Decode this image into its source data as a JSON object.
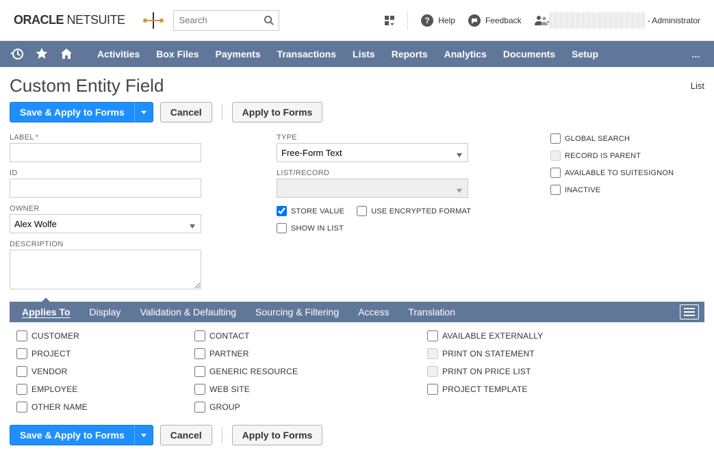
{
  "topbar": {
    "logo_oracle": "ORACLE",
    "logo_netsuite": "NETSUITE",
    "search_placeholder": "Search",
    "help_label": "Help",
    "feedback_label": "Feedback",
    "role_suffix": "- Administrator"
  },
  "nav": {
    "items": [
      "Activities",
      "Box Files",
      "Payments",
      "Transactions",
      "Lists",
      "Reports",
      "Analytics",
      "Documents",
      "Setup"
    ]
  },
  "page": {
    "title": "Custom Entity Field",
    "list_link": "List"
  },
  "buttons": {
    "save_apply": "Save & Apply to Forms",
    "cancel": "Cancel",
    "apply_forms": "Apply to Forms"
  },
  "form": {
    "label": {
      "label": "LABEL",
      "value": ""
    },
    "id": {
      "label": "ID",
      "value": ""
    },
    "owner": {
      "label": "OWNER",
      "value": "Alex Wolfe"
    },
    "description": {
      "label": "DESCRIPTION",
      "value": ""
    },
    "type": {
      "label": "TYPE",
      "value": "Free-Form Text"
    },
    "list_record": {
      "label": "LIST/RECORD",
      "value": ""
    },
    "store_value": {
      "label": "STORE VALUE",
      "checked": true
    },
    "use_encrypted": {
      "label": "USE ENCRYPTED FORMAT",
      "checked": false
    },
    "show_in_list": {
      "label": "SHOW IN LIST",
      "checked": false
    },
    "global_search": {
      "label": "GLOBAL SEARCH",
      "checked": false
    },
    "record_is_parent": {
      "label": "RECORD IS PARENT",
      "checked": false
    },
    "available_suitesignon": {
      "label": "AVAILABLE TO SUITESIGNON",
      "checked": false
    },
    "inactive": {
      "label": "INACTIVE",
      "checked": false
    }
  },
  "subtabs": [
    "Applies To",
    "Display",
    "Validation & Defaulting",
    "Sourcing & Filtering",
    "Access",
    "Translation"
  ],
  "applies_to": {
    "col1": [
      "CUSTOMER",
      "PROJECT",
      "VENDOR",
      "EMPLOYEE",
      "OTHER NAME"
    ],
    "col2": [
      "CONTACT",
      "PARTNER",
      "GENERIC RESOURCE",
      "WEB SITE",
      "GROUP"
    ],
    "col3": [
      "AVAILABLE EXTERNALLY",
      "PRINT ON STATEMENT",
      "PRINT ON PRICE LIST",
      "PROJECT TEMPLATE"
    ]
  }
}
